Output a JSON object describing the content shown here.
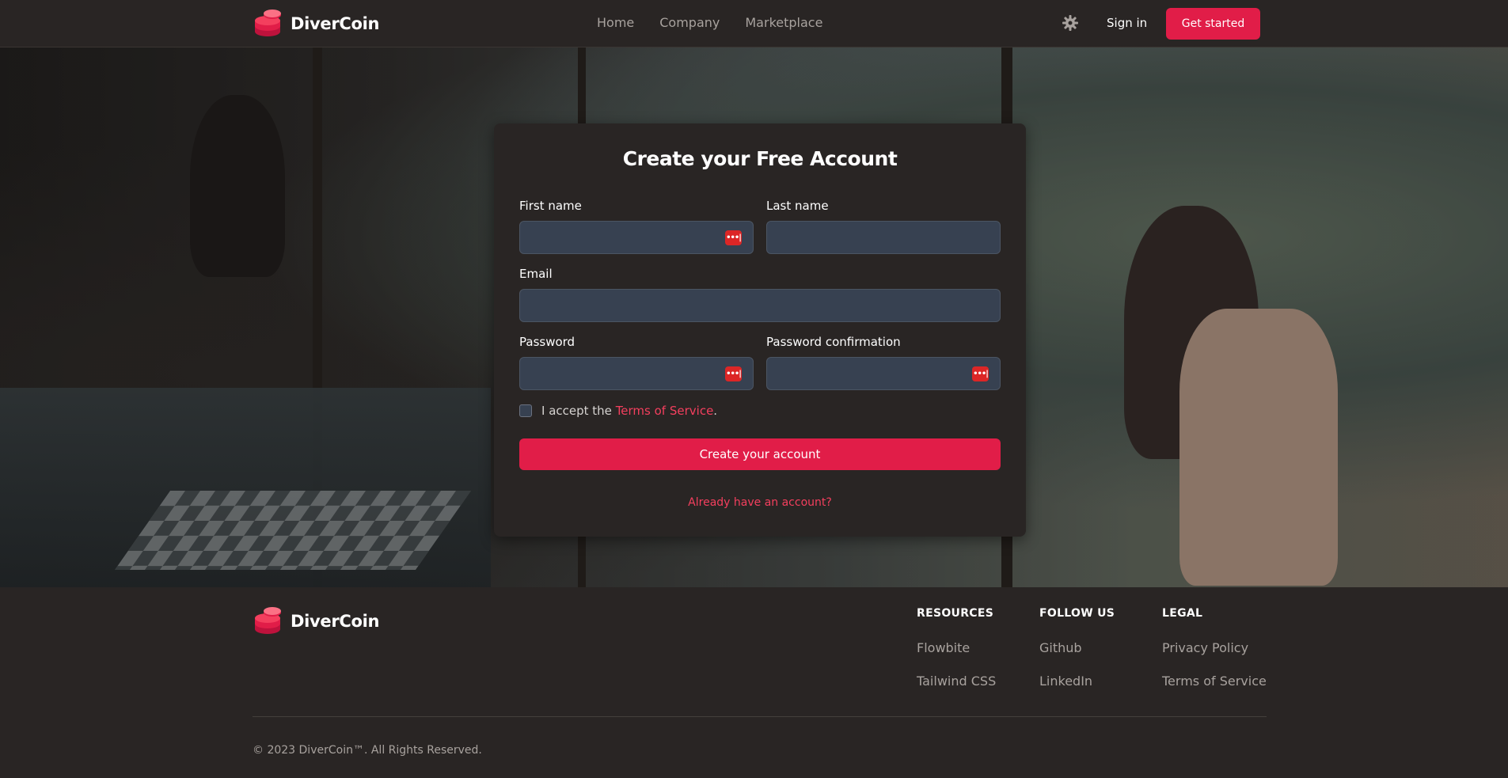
{
  "brand": {
    "name": "DiverCoin",
    "accent": "#e11d48"
  },
  "nav": {
    "links": [
      {
        "label": "Home"
      },
      {
        "label": "Company"
      },
      {
        "label": "Marketplace"
      }
    ],
    "theme_icon": "gear-icon",
    "sign_in": "Sign in",
    "get_started": "Get started"
  },
  "form": {
    "title": "Create your Free Account",
    "first_name": {
      "label": "First name",
      "value": ""
    },
    "last_name": {
      "label": "Last name",
      "value": ""
    },
    "email": {
      "label": "Email",
      "value": ""
    },
    "password": {
      "label": "Password",
      "value": ""
    },
    "password_confirmation": {
      "label": "Password confirmation",
      "value": ""
    },
    "terms_prefix": "I accept the",
    "terms_link": "Terms of Service",
    "terms_suffix": ".",
    "terms_checked": false,
    "submit": "Create your account",
    "already": "Already have an account?"
  },
  "footer": {
    "brand": "DiverCoin",
    "columns": [
      {
        "heading": "RESOURCES",
        "links": [
          "Flowbite",
          "Tailwind CSS"
        ]
      },
      {
        "heading": "FOLLOW US",
        "links": [
          "Github",
          "LinkedIn"
        ]
      },
      {
        "heading": "LEGAL",
        "links": [
          "Privacy Policy",
          "Terms of Service"
        ]
      }
    ],
    "copyright": "© 2023 DiverCoin™. All Rights Reserved."
  }
}
